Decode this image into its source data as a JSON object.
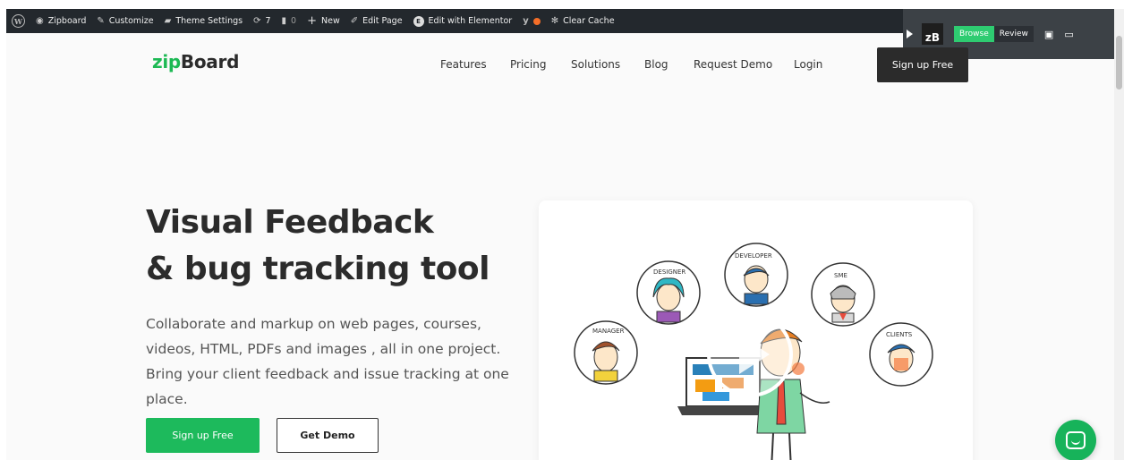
{
  "adminbar": {
    "site_name": "Zipboard",
    "customize": "Customize",
    "theme_settings": "Theme Settings",
    "updates_count": "7",
    "comments_count": "0",
    "new_label": "New",
    "edit_page": "Edit Page",
    "edit_elementor": "Edit with Elementor",
    "clear_cache": "Clear Cache"
  },
  "zipboard_bar": {
    "logo": "zB",
    "browse": "Browse",
    "review": "Review"
  },
  "header": {
    "logo_accent": "zip",
    "logo_main": "Board",
    "nav": [
      "Features",
      "Pricing",
      "Solutions",
      "Blog",
      "Request Demo",
      "Login"
    ],
    "signup": "Sign up Free"
  },
  "hero": {
    "title_line1": "Visual Feedback",
    "title_line2": "& bug tracking tool",
    "subtitle": "Collaborate and markup on web pages, courses, videos, HTML, PDFs and images , all in one project. Bring your client feedback and issue tracking at one place.",
    "primary_cta": "Sign up Free",
    "secondary_cta": "Get Demo"
  },
  "illustration": {
    "labels": {
      "designer": "DESIGNER",
      "developer": "DEVELOPER",
      "sme": "SME",
      "manager": "MANAGER",
      "clients": "CLIENTS"
    }
  },
  "colors": {
    "brand_green": "#1dba5c",
    "dark": "#2b2b2b",
    "adminbar": "#23282d"
  }
}
